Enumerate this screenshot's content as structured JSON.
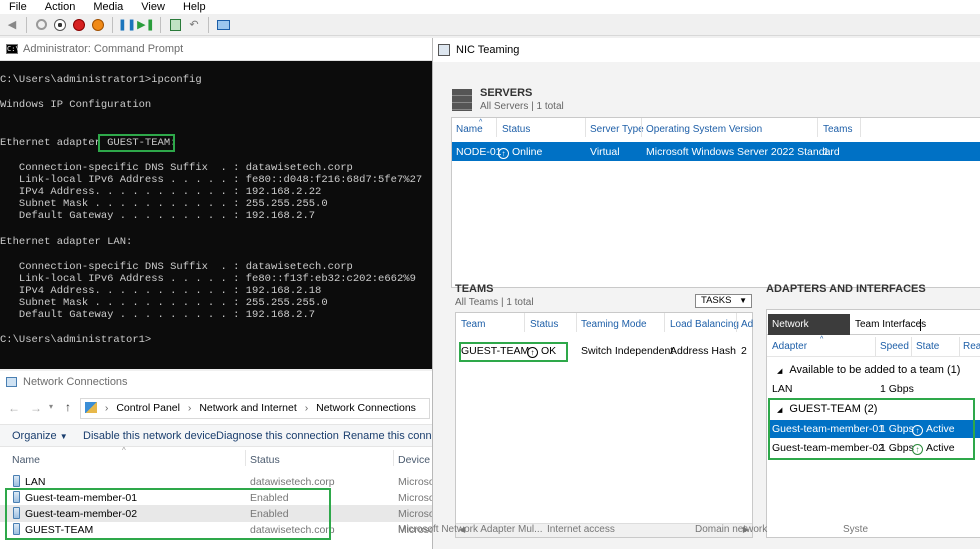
{
  "menu": [
    "File",
    "Action",
    "Media",
    "View",
    "Help"
  ],
  "toolbar_icons": [
    "back-icon",
    "ctrl-alt-del-icon",
    "stop-icon",
    "shutdown-icon",
    "power-icon",
    "pause-icon",
    "play-icon",
    "checkpoint-icon",
    "revert-icon",
    "enhanced-session-icon"
  ],
  "cmd": {
    "title": "Administrator: Command Prompt",
    "prompt1": "C:\\Users\\administrator1>ipconfig",
    "header": "Windows IP Configuration",
    "adapter1_prefix": "Ethernet adapter ",
    "adapter1_name": "GUEST-TEAM:",
    "a1_dns": "   Connection-specific DNS Suffix  . : datawisetech.corp",
    "a1_ipv6": "   Link-local IPv6 Address . . . . . : fe80::d048:f216:68d7:5fe7%27",
    "a1_ipv4": "   IPv4 Address. . . . . . . . . . . : 192.168.2.22",
    "a1_mask": "   Subnet Mask . . . . . . . . . . . : 255.255.255.0",
    "a1_gw": "   Default Gateway . . . . . . . . . : 192.168.2.7",
    "adapter2": "Ethernet adapter LAN:",
    "a2_dns": "   Connection-specific DNS Suffix  . : datawisetech.corp",
    "a2_ipv6": "   Link-local IPv6 Address . . . . . : fe80::f13f:eb32:c202:e662%9",
    "a2_ipv4": "   IPv4 Address. . . . . . . . . . . : 192.168.2.18",
    "a2_mask": "   Subnet Mask . . . . . . . . . . . : 255.255.255.0",
    "a2_gw": "   Default Gateway . . . . . . . . . : 192.168.2.7",
    "prompt2": "C:\\Users\\administrator1>"
  },
  "nic": {
    "title": "NIC Teaming",
    "servers": {
      "title": "SERVERS",
      "sub": "All Servers | 1 total",
      "headers": [
        "Name",
        "Status",
        "Server Type",
        "Operating System Version",
        "Teams"
      ],
      "row": {
        "name": "NODE-01",
        "status": "Online",
        "type": "Virtual",
        "os": "Microsoft Windows Server 2022 Standard",
        "teams": "1"
      }
    },
    "teams": {
      "title": "TEAMS",
      "sub": "All Teams | 1 total",
      "tasks": "TASKS",
      "headers": [
        "Team",
        "Status",
        "Teaming Mode",
        "Load Balancing",
        "Ad"
      ],
      "row": {
        "team": "GUEST-TEAM",
        "status": "OK",
        "mode": "Switch Independent",
        "lb": "Address Hash",
        "ad": "2"
      }
    },
    "adapters": {
      "title": "ADAPTERS AND INTERFACES",
      "tab1": "Network Adapters",
      "tab2": "Team Interfaces",
      "headers": [
        "Adapter",
        "Speed",
        "State",
        "Reas"
      ],
      "group1": "Available to be added to a team (1)",
      "lan": {
        "name": "LAN",
        "speed": "1 Gbps"
      },
      "group2": "GUEST-TEAM (2)",
      "m1": {
        "name": "Guest-team-member-01",
        "speed": "1 Gbps",
        "state": "Active"
      },
      "m2": {
        "name": "Guest-team-member-02",
        "speed": "1 Gbps",
        "state": "Active"
      }
    }
  },
  "nc": {
    "title": "Network Connections",
    "crumbs": [
      "Control Panel",
      "Network and Internet",
      "Network Connections"
    ],
    "cmds": [
      "Organize",
      "Disable this network device",
      "Diagnose this connection",
      "Rename this connecti"
    ],
    "headers": [
      "Name",
      "Status",
      "Device N"
    ],
    "rows": [
      {
        "name": "LAN",
        "status": "datawisetech.corp",
        "device": "Microso"
      },
      {
        "name": "Guest-team-member-01",
        "status": "Enabled",
        "device": "Microso"
      },
      {
        "name": "Guest-team-member-02",
        "status": "Enabled",
        "device": "Microso"
      },
      {
        "name": "GUEST-TEAM",
        "status": "datawisetech.corp",
        "device": "Microsoft Network Adapter Mul..."
      }
    ],
    "extra": {
      "access": "Internet access",
      "category": "Domain network",
      "owner": "Syste"
    }
  }
}
